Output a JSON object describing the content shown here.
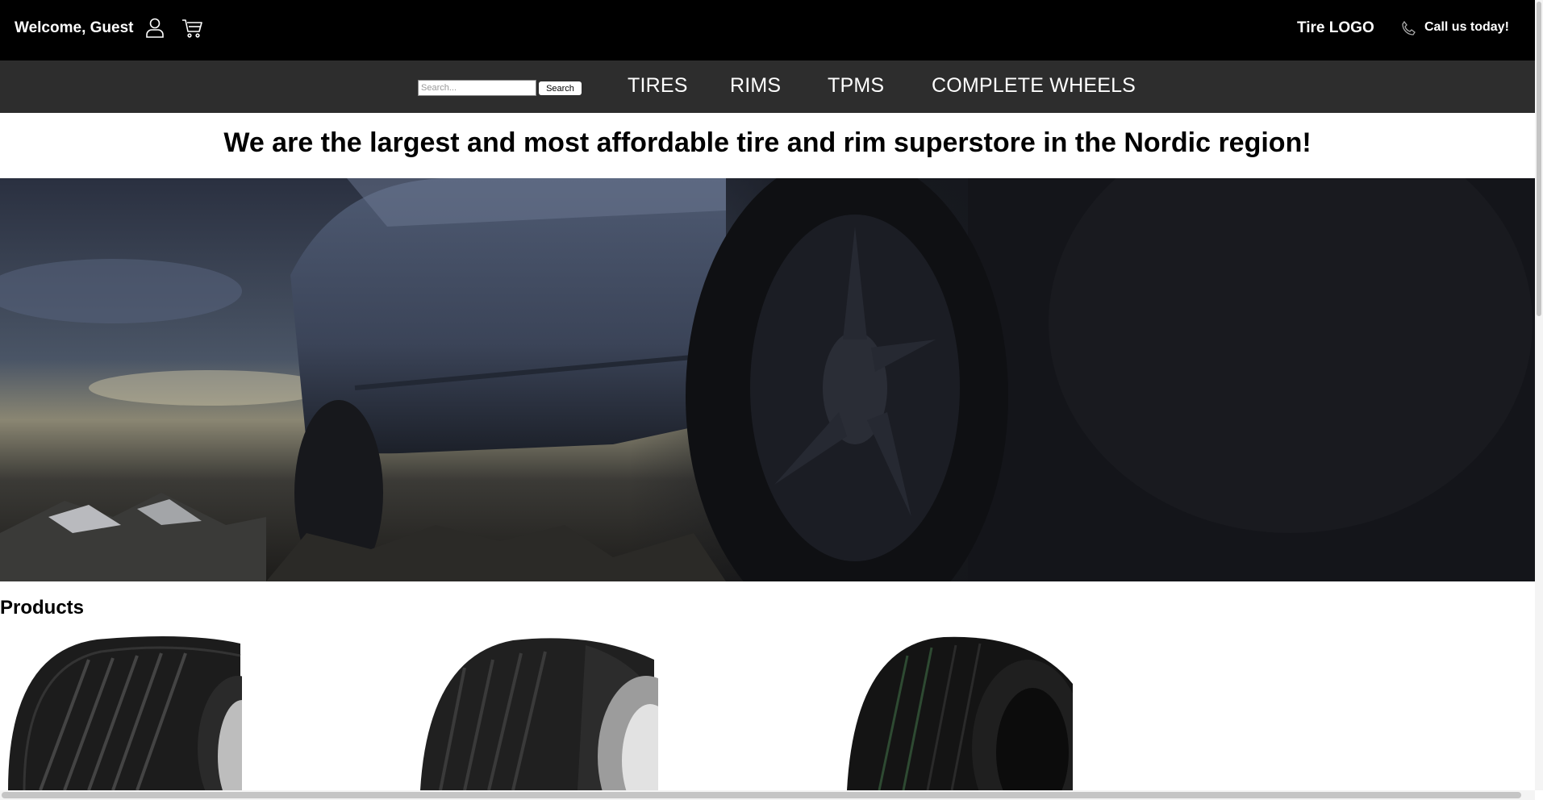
{
  "header": {
    "welcome": "Welcome, Guest",
    "user_icon": "user-icon",
    "cart_icon": "cart-icon",
    "logo": "Tire LOGO",
    "phone_icon": "phone-icon",
    "call": "Call us today!"
  },
  "nav": {
    "search_placeholder": "Search...",
    "search_button": "Search",
    "links": [
      "TIRES",
      "RIMS",
      "TPMS",
      "COMPLETE WHEELS"
    ]
  },
  "headline": "We are the largest and most affordable tire and rim superstore in the Nordic region!",
  "products": {
    "title": "Products"
  },
  "colors": {
    "topbar": "#000000",
    "navbar": "#2d2d2d",
    "text": "#ffffff"
  }
}
